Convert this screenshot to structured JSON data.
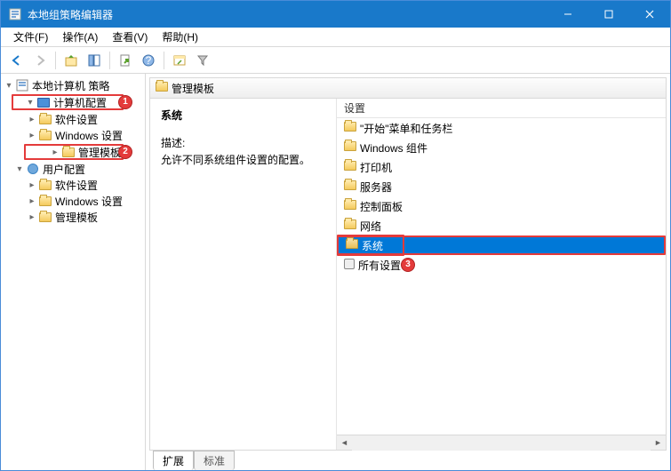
{
  "window": {
    "title": "本地组策略编辑器"
  },
  "menu": {
    "file": "文件(F)",
    "action": "操作(A)",
    "view": "查看(V)",
    "help": "帮助(H)"
  },
  "tree": {
    "root": "本地计算机 策略",
    "computer": "计算机配置",
    "computer_children": [
      "软件设置",
      "Windows 设置",
      "管理模板"
    ],
    "user": "用户配置",
    "user_children": [
      "软件设置",
      "Windows 设置",
      "管理模板"
    ]
  },
  "badges": {
    "one": "1",
    "two": "2",
    "three": "3"
  },
  "header": {
    "path": "管理模板"
  },
  "detail": {
    "name": "系统",
    "desc_label": "描述:",
    "desc": "允许不同系统组件设置的配置。",
    "col": "设置"
  },
  "items": [
    "\"开始\"菜单和任务栏",
    "Windows 组件",
    "打印机",
    "服务器",
    "控制面板",
    "网络",
    "系统",
    "所有设置"
  ],
  "tabs": {
    "extended": "扩展",
    "standard": "标准"
  }
}
